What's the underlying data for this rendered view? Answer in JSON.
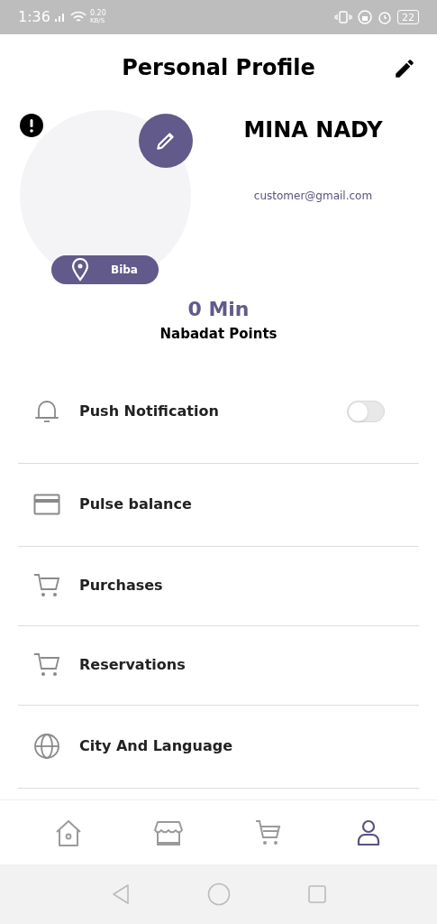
{
  "status_bar": {
    "time": "1:36",
    "speed": "0.20",
    "speed_unit": "KB/S",
    "battery": "22"
  },
  "header": {
    "title": "Personal Profile"
  },
  "profile": {
    "name": "MINA NADY",
    "email": "customer@gmail.com",
    "location": "Biba",
    "minutes": "0 Min",
    "points_label": "Nabadat Points"
  },
  "menu": [
    {
      "kind": "toggle",
      "label": "Push Notification",
      "on": false
    },
    {
      "kind": "link",
      "label": "Pulse balance"
    },
    {
      "kind": "link",
      "label": "Purchases"
    },
    {
      "kind": "link",
      "label": "Reservations"
    },
    {
      "kind": "link",
      "label": "City And Language"
    }
  ],
  "bottom_nav": [
    {
      "selected": false
    },
    {
      "selected": false
    },
    {
      "selected": false
    },
    {
      "selected": true
    }
  ]
}
